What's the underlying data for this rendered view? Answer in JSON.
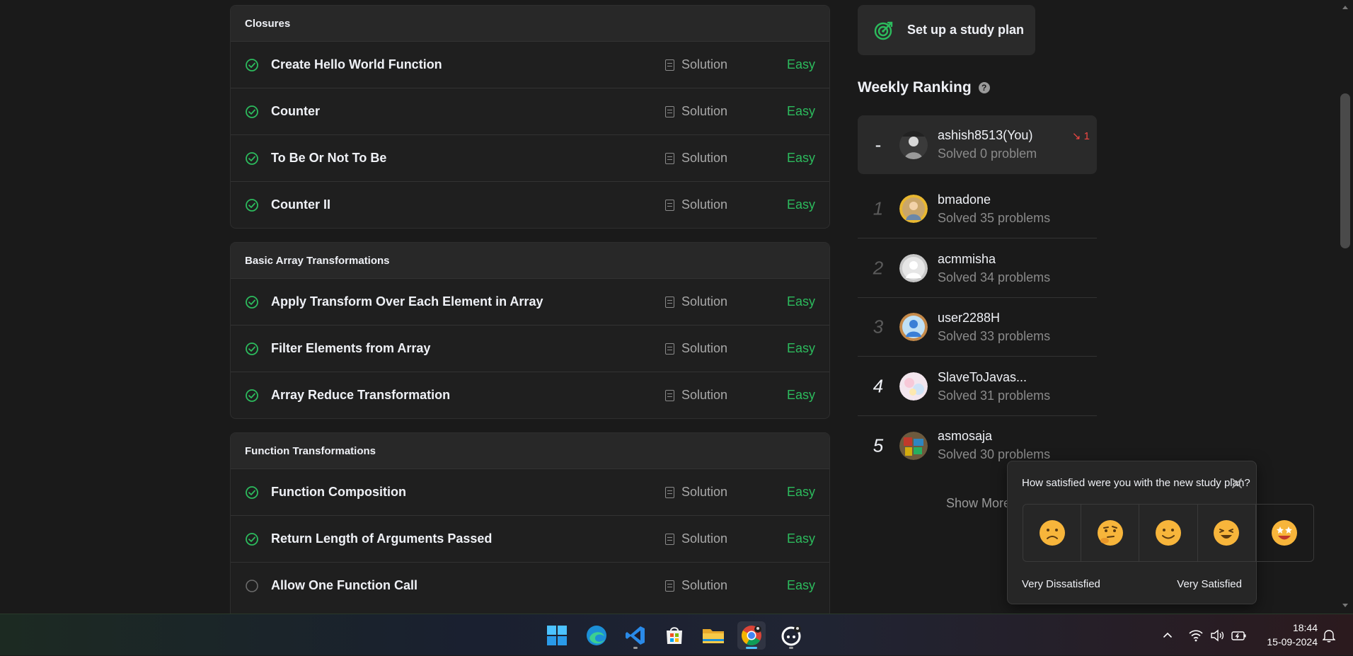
{
  "groups": [
    {
      "title": "Closures",
      "problems": [
        {
          "title": "Create Hello World Function",
          "solution": "Solution",
          "difficulty": "Easy",
          "solved": true
        },
        {
          "title": "Counter",
          "solution": "Solution",
          "difficulty": "Easy",
          "solved": true
        },
        {
          "title": "To Be Or Not To Be",
          "solution": "Solution",
          "difficulty": "Easy",
          "solved": true
        },
        {
          "title": "Counter II",
          "solution": "Solution",
          "difficulty": "Easy",
          "solved": true
        }
      ]
    },
    {
      "title": "Basic Array Transformations",
      "problems": [
        {
          "title": "Apply Transform Over Each Element in Array",
          "solution": "Solution",
          "difficulty": "Easy",
          "solved": true
        },
        {
          "title": "Filter Elements from Array",
          "solution": "Solution",
          "difficulty": "Easy",
          "solved": true
        },
        {
          "title": "Array Reduce Transformation",
          "solution": "Solution",
          "difficulty": "Easy",
          "solved": true
        }
      ]
    },
    {
      "title": "Function Transformations",
      "problems": [
        {
          "title": "Function Composition",
          "solution": "Solution",
          "difficulty": "Easy",
          "solved": true
        },
        {
          "title": "Return Length of Arguments Passed",
          "solution": "Solution",
          "difficulty": "Easy",
          "solved": true
        },
        {
          "title": "Allow One Function Call",
          "solution": "Solution",
          "difficulty": "Easy",
          "solved": false
        }
      ]
    }
  ],
  "sidebar": {
    "study_plan_label": "Set up a study plan",
    "weekly_title": "Weekly Ranking",
    "help_glyph": "?",
    "show_more": "Show More",
    "ranking": [
      {
        "rank": "-",
        "username": "ashish8513(You)",
        "solved": "Solved 0 problem",
        "delta": "↘ 1",
        "you": true
      },
      {
        "rank": "1",
        "username": "bmadone",
        "solved": "Solved 35 problems"
      },
      {
        "rank": "2",
        "username": "acmmisha",
        "solved": "Solved 34 problems"
      },
      {
        "rank": "3",
        "username": "user2288H",
        "solved": "Solved 33 problems"
      },
      {
        "rank": "4",
        "username": "SlaveToJavas...",
        "solved": "Solved 31 problems"
      },
      {
        "rank": "5",
        "username": "asmosaja",
        "solved": "Solved 30 problems"
      }
    ]
  },
  "feedback": {
    "question": "How satisfied were you with the new study plan?",
    "low_label": "Very Dissatisfied",
    "high_label": "Very Satisfied",
    "options": [
      "very-dissatisfied",
      "dissatisfied",
      "neutral",
      "satisfied",
      "very-satisfied"
    ]
  },
  "taskbar": {
    "time": "18:44",
    "date": "15-09-2024"
  },
  "colors": {
    "easy": "#2cbb5d",
    "solved_check": "#2cbb5d",
    "rank_down": "#ef4743",
    "background": "#1a1a1a"
  }
}
